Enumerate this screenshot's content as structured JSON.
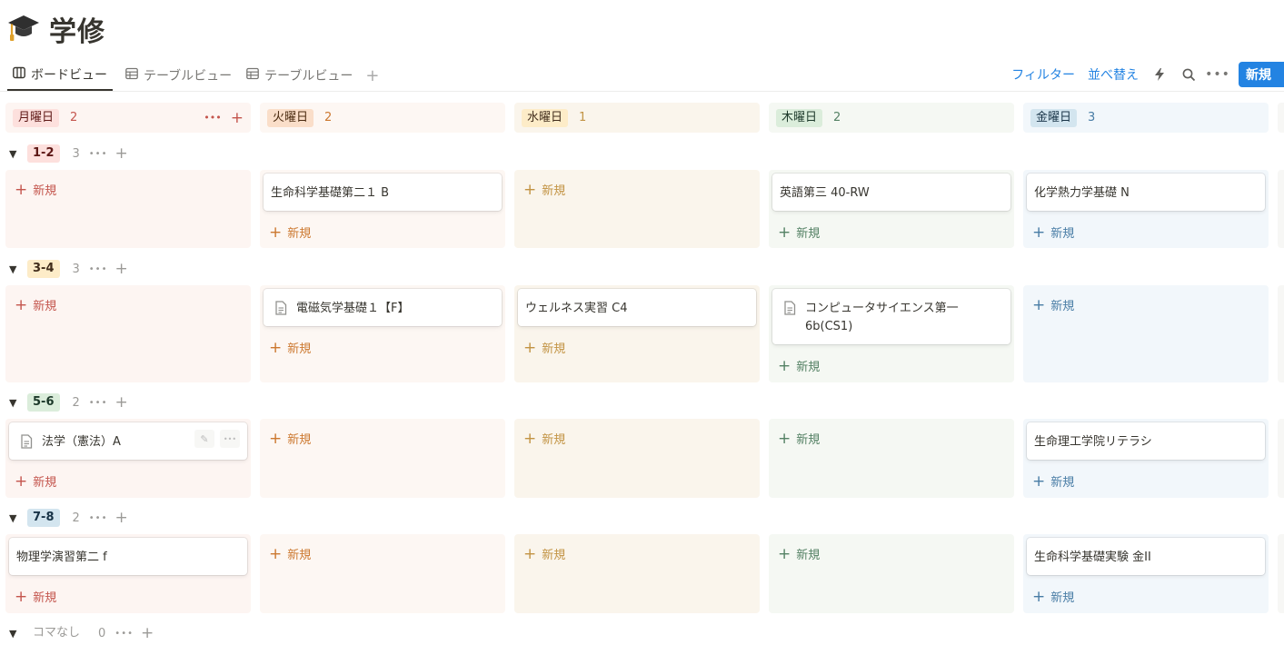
{
  "page": {
    "title": "学修",
    "icon": "graduation-cap-icon"
  },
  "views": [
    {
      "label": "ボードビュー",
      "icon": "board-icon",
      "active": true
    },
    {
      "label": "テーブルビュー",
      "icon": "table-icon",
      "active": false
    },
    {
      "label": "テーブルビュー",
      "icon": "table-icon",
      "active": false
    }
  ],
  "toolbar": {
    "filter": "フィルター",
    "sort": "並べ替え",
    "new": "新規"
  },
  "new_label": "新規",
  "columns": [
    {
      "name": "月曜日",
      "count": "2",
      "tag_bg": "#fde0dd",
      "tag_fg": "#5d1715",
      "count_fg": "#c4554d",
      "cell_bg": "#fdf5f2",
      "add_fg": "#c4554d"
    },
    {
      "name": "火曜日",
      "count": "2",
      "tag_bg": "#fadec9",
      "tag_fg": "#49290e",
      "count_fg": "#cc782f",
      "cell_bg": "#fdf7f3",
      "add_fg": "#cc782f"
    },
    {
      "name": "水曜日",
      "count": "1",
      "tag_bg": "#fdecc8",
      "tag_fg": "#402c1b",
      "count_fg": "#c29343",
      "cell_bg": "#faf5ec",
      "add_fg": "#c29343"
    },
    {
      "name": "木曜日",
      "count": "2",
      "tag_bg": "#dbeddb",
      "tag_fg": "#1c3829",
      "count_fg": "#548164",
      "cell_bg": "#f5f8f3",
      "add_fg": "#548164"
    },
    {
      "name": "金曜日",
      "count": "3",
      "tag_bg": "#d3e5ef",
      "tag_fg": "#183347",
      "count_fg": "#487ca5",
      "cell_bg": "#f2f7fb",
      "add_fg": "#487ca5"
    }
  ],
  "groups": [
    {
      "label": "1-2",
      "count": "3",
      "tag_bg": "#fde0dd",
      "tag_fg": "#5d1715",
      "cells": [
        [],
        [
          {
            "text": "生命科学基礎第二１ B",
            "doc": false
          }
        ],
        [],
        [
          {
            "text": "英語第三 40-RW",
            "doc": false
          }
        ],
        [
          {
            "text": "化学熱力学基礎 N",
            "doc": false
          }
        ]
      ]
    },
    {
      "label": "3-4",
      "count": "3",
      "tag_bg": "#fdecc8",
      "tag_fg": "#402c1b",
      "cells": [
        [],
        [
          {
            "text": "電磁気学基礎１【F】",
            "doc": true
          }
        ],
        [
          {
            "text": "ウェルネス実習 C4",
            "doc": false
          }
        ],
        [
          {
            "text": "コンピュータサイエンス第一 6b(CS1)",
            "doc": true,
            "lines": [
              "コンピュータサイエンス第一",
              "6b(CS1)"
            ]
          }
        ],
        []
      ]
    },
    {
      "label": "5-6",
      "count": "2",
      "tag_bg": "#dbeddb",
      "tag_fg": "#1c3829",
      "cells": [
        [
          {
            "text": "法学（憲法）A",
            "doc": true,
            "hover": true
          }
        ],
        [],
        [],
        [],
        [
          {
            "text": "生命理工学院リテラシ",
            "doc": false
          }
        ]
      ]
    },
    {
      "label": "7-8",
      "count": "2",
      "tag_bg": "#d3e5ef",
      "tag_fg": "#183347",
      "cells": [
        [
          {
            "text": "物理学演習第二 f",
            "doc": false
          }
        ],
        [],
        [],
        [],
        [
          {
            "text": "生命科学基礎実験 金II",
            "doc": false
          }
        ]
      ]
    }
  ],
  "last_group": {
    "label": "コマなし",
    "count": "0"
  }
}
